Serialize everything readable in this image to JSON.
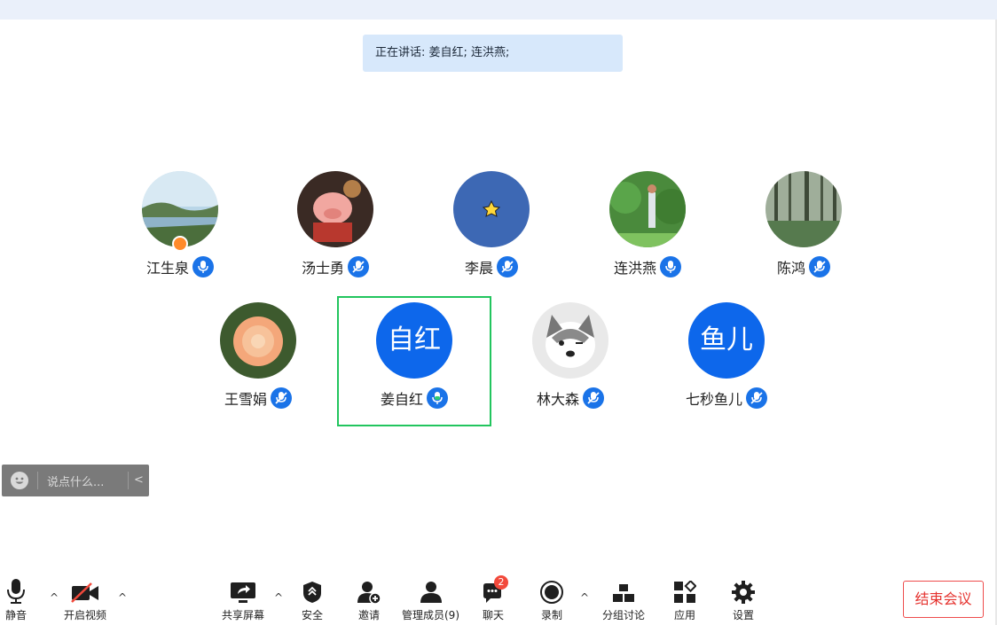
{
  "speaking": {
    "text": "正在讲话: 姜自红; 连洪燕;"
  },
  "participants": [
    {
      "name": "江生泉",
      "mic": "on"
    },
    {
      "name": "汤士勇",
      "mic": "muted"
    },
    {
      "name": "李晨",
      "mic": "muted"
    },
    {
      "name": "连洪燕",
      "mic": "on"
    },
    {
      "name": "陈鸿",
      "mic": "muted"
    },
    {
      "name": "王雪娟",
      "mic": "muted"
    },
    {
      "name": "姜自红",
      "mic": "speaking",
      "avatar_text": "自红"
    },
    {
      "name": "林大森",
      "mic": "muted"
    },
    {
      "name": "七秒鱼儿",
      "mic": "muted",
      "avatar_text": "鱼儿"
    }
  ],
  "chat": {
    "placeholder": "说点什么...",
    "collapse": "<"
  },
  "toolbar": {
    "mute": "静音",
    "video": "开启视频",
    "share": "共享屏幕",
    "security": "安全",
    "invite": "邀请",
    "manage": "管理成员(9)",
    "chat": "聊天",
    "chat_badge": "2",
    "record": "录制",
    "breakout": "分组讨论",
    "apps": "应用",
    "settings": "设置",
    "end": "结束会议",
    "caret": "^"
  },
  "colors": {
    "accent": "#1a73e8",
    "speaking_bg": "#d7e8fb",
    "selected_border": "#22c55e",
    "end_red": "#e5322e"
  }
}
